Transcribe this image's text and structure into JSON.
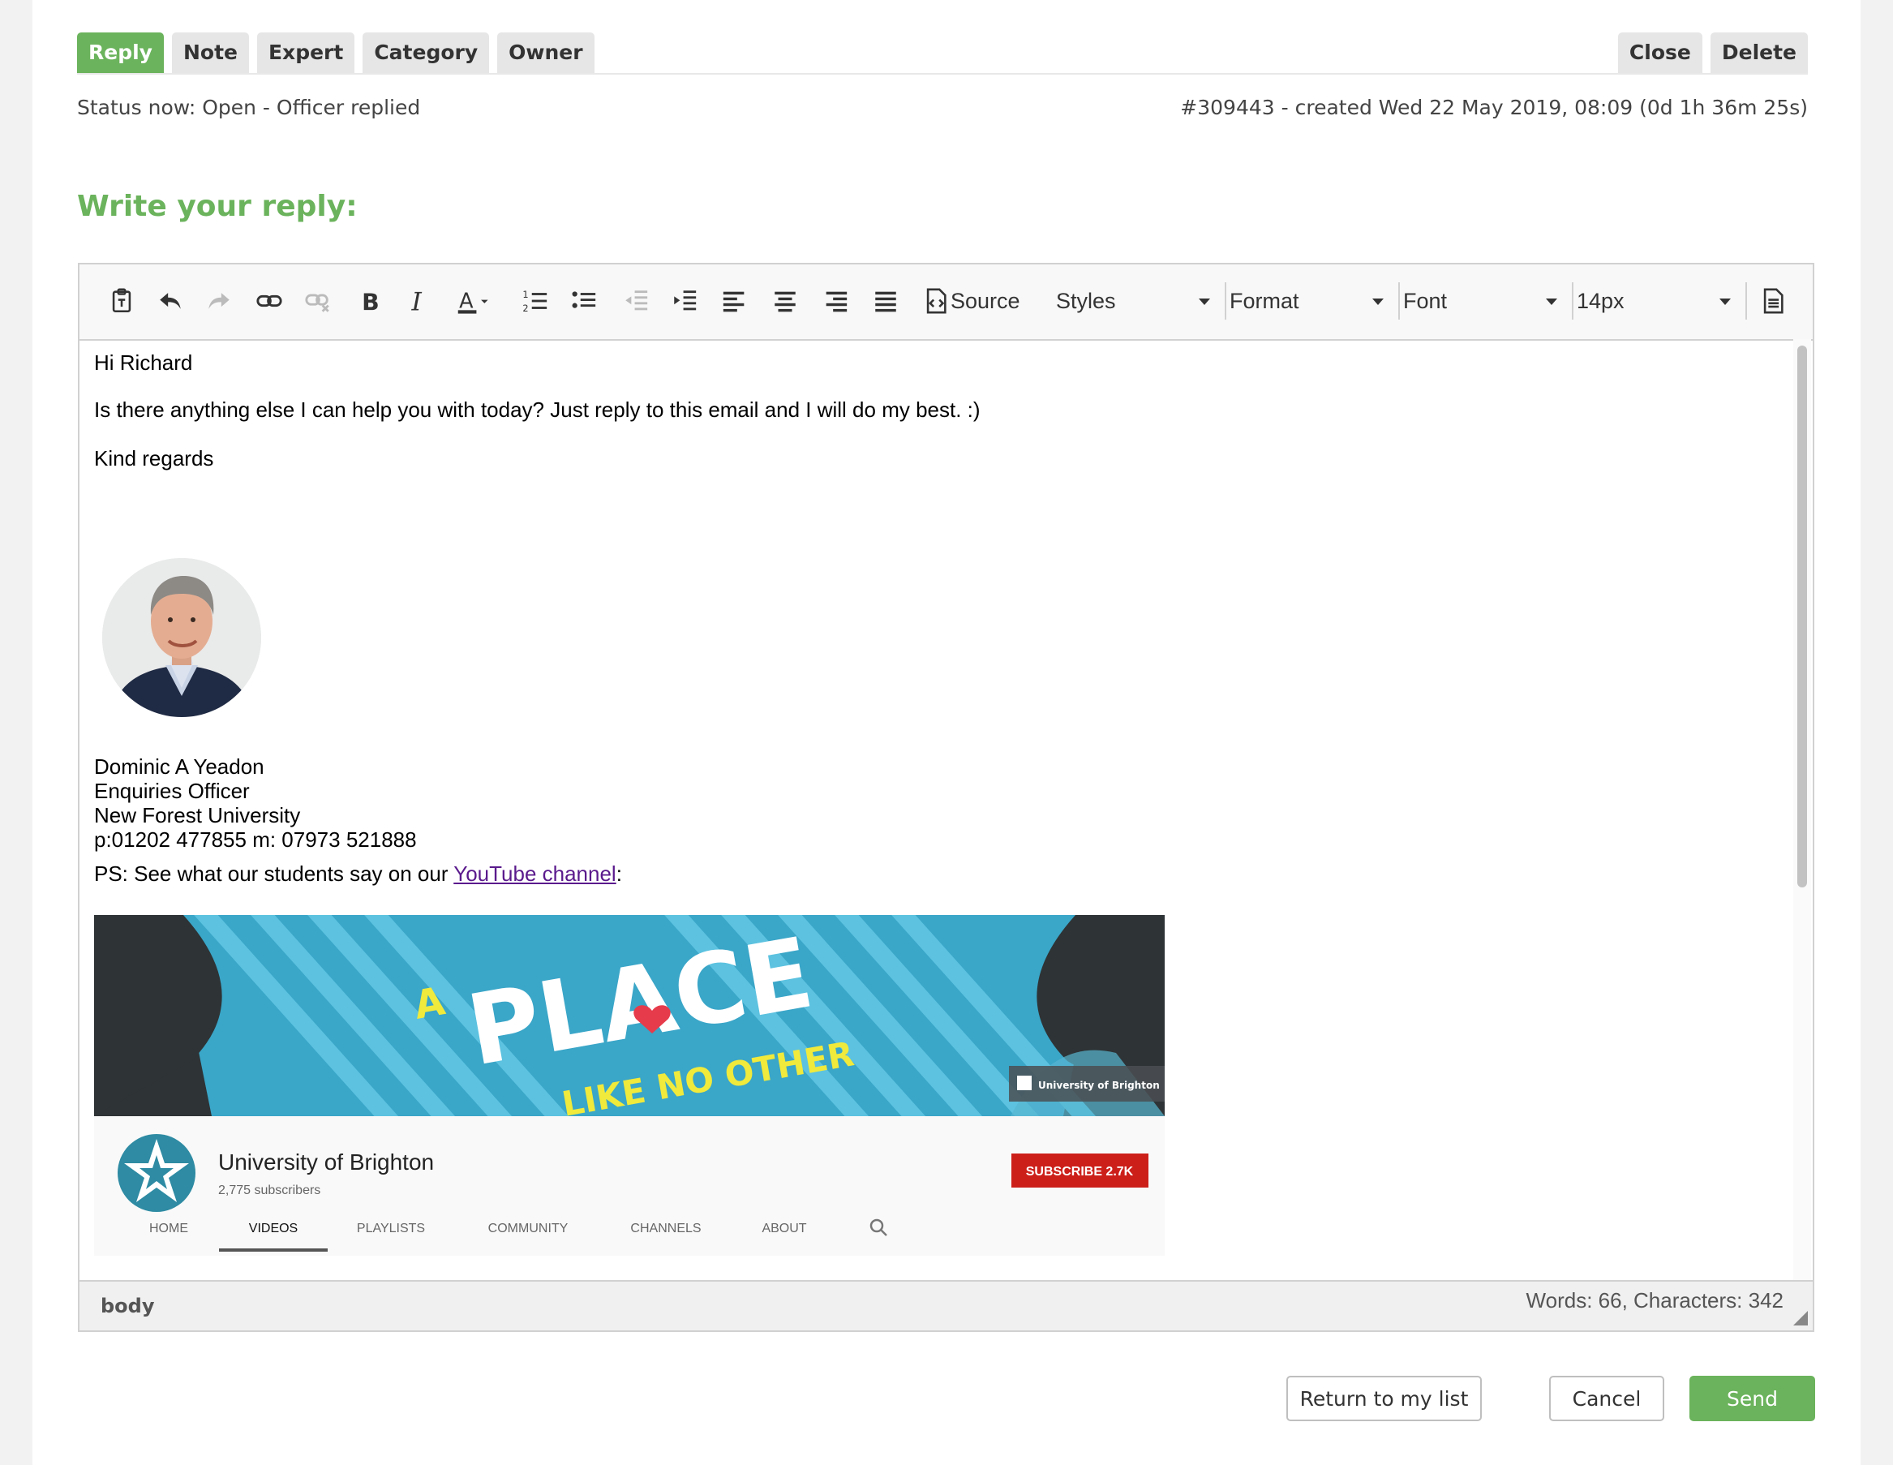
{
  "tabs_left": [
    "Reply",
    "Note",
    "Expert",
    "Category",
    "Owner"
  ],
  "tabs_right": [
    "Close",
    "Delete"
  ],
  "status": {
    "left": "Status now: Open - Officer replied",
    "right": "#309443 - created Wed 22 May 2019, 08:09 (0d 1h 36m 25s)"
  },
  "heading": "Write your reply:",
  "toolbar": {
    "source_label": "Source",
    "styles_label": "Styles",
    "format_label": "Format",
    "font_label": "Font",
    "size_label": "14px",
    "icons": [
      "paste-text-icon",
      "undo-icon",
      "redo-icon",
      "link-icon",
      "unlink-icon",
      "bold-icon",
      "italic-icon",
      "text-color-icon",
      "numbered-list-icon",
      "bulleted-list-icon",
      "outdent-icon",
      "indent-icon",
      "align-left-icon",
      "align-center-icon",
      "align-right-icon",
      "justify-icon",
      "source-icon",
      "document-icon"
    ]
  },
  "body": {
    "greeting": "Hi Richard",
    "line1": "Is there anything else I can help you with today? Just reply to this email and I will do my best. :)",
    "closing": "Kind regards",
    "sig_name": "Dominic A Yeadon",
    "sig_title": "Enquiries Officer",
    "sig_org": "New Forest University",
    "sig_phone": "p:01202 477855  m: 07973 521888",
    "ps_prefix": "PS: See what our students say on our ",
    "ps_link": "YouTube channel",
    "ps_suffix": ":"
  },
  "banner": {
    "word_a": "A",
    "word_place": "PLACE",
    "tagline": "LIKE NO OTHER",
    "corner_label": "University of Brighton",
    "channel_name": "University of Brighton",
    "subscribers": "2,775 subscribers",
    "subscribe_label": "SUBSCRIBE  2.7K",
    "nav": [
      "HOME",
      "VIDEOS",
      "PLAYLISTS",
      "COMMUNITY",
      "CHANNELS",
      "ABOUT"
    ],
    "active_nav": "VIDEOS",
    "colors": {
      "teal": "#3aa6c8",
      "dark": "#2e3335",
      "yellow": "#f0ea3c",
      "subscribe_red": "#cc1f1a"
    }
  },
  "statusbar": {
    "path": "body",
    "count": "Words: 66, Characters: 342"
  },
  "buttons": {
    "return": "Return to my list",
    "cancel": "Cancel",
    "send": "Send"
  },
  "colors": {
    "accent_green": "#6bb35c",
    "link_purple": "#5a1a8c"
  }
}
